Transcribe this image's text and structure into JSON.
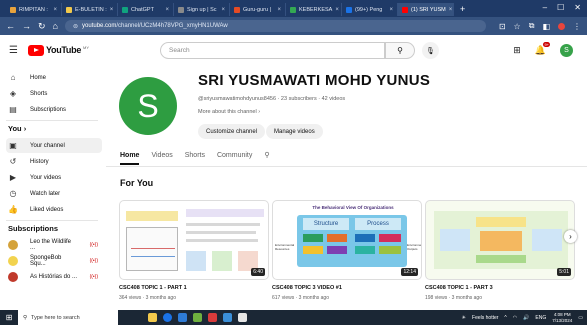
{
  "browser": {
    "tabs": [
      {
        "label": "RIMPITAN :",
        "color": "#e8a33d"
      },
      {
        "label": "E-BULETIN :",
        "color": "#f2c94c"
      },
      {
        "label": "ChatGPT",
        "color": "#10a37f"
      },
      {
        "label": "Sign up | Sc",
        "color": "#8a8a8a"
      },
      {
        "label": "Guru-guru |",
        "color": "#e44b25"
      },
      {
        "label": "KEBERKESA",
        "color": "#34a853"
      },
      {
        "label": "(99+) Peng",
        "color": "#1a73e8"
      },
      {
        "label": "(1) SRI YUSM",
        "color": "#ff0000"
      }
    ],
    "new_tab": "+",
    "url_domain": "youtube.com",
    "url_path": "/channel/UCzM4h78VPG_xmyHN1UWAw"
  },
  "youtube": {
    "logo_text": "YouTube",
    "logo_cc": "MY",
    "search_placeholder": "Search",
    "notif_badge": "9+",
    "user_initial": "S"
  },
  "sidebar": {
    "top": [
      {
        "label": "Home",
        "icon": "home-icon",
        "glyph": "⌂"
      },
      {
        "label": "Shorts",
        "icon": "shorts-icon",
        "glyph": "◈"
      },
      {
        "label": "Subscriptions",
        "icon": "subscriptions-icon",
        "glyph": "▤"
      }
    ],
    "you_heading": "You  ›",
    "you": [
      {
        "label": "Your channel",
        "icon": "your-channel-icon",
        "glyph": "▣"
      },
      {
        "label": "History",
        "icon": "history-icon",
        "glyph": "↺"
      },
      {
        "label": "Your videos",
        "icon": "your-videos-icon",
        "glyph": "▶"
      },
      {
        "label": "Watch later",
        "icon": "watch-later-icon",
        "glyph": "◷"
      },
      {
        "label": "Liked videos",
        "icon": "liked-videos-icon",
        "glyph": "👍"
      }
    ],
    "subs_heading": "Subscriptions",
    "subs": [
      {
        "label": "Leo the Wildlife ...",
        "color": "#d4a23a",
        "live": "((•))"
      },
      {
        "label": "SpongeBob Squ...",
        "color": "#f2d34f",
        "live": "((•))"
      },
      {
        "label": "As Histórias do ...",
        "color": "#c0392b",
        "live": "((•))"
      }
    ]
  },
  "channel": {
    "avatar_letter": "S",
    "name": "SRI YUSMAWATI MOHD YUNUS",
    "meta": "@sriyusmawatimohdyunus8456 · 23 subscribers · 42 videos",
    "about": "More about this channel  ›",
    "customize_label": "Customize channel",
    "manage_label": "Manage videos"
  },
  "tabs": [
    "Home",
    "Videos",
    "Shorts",
    "Community"
  ],
  "section_title": "For You",
  "videos": [
    {
      "title": "CSC408 TOPIC 1 - PART 1",
      "meta": "364 views · 3 months ago",
      "duration": "6:40"
    },
    {
      "title": "CSC408 TOPIC 3 VIDEO #1",
      "meta": "617 views · 3 months ago",
      "duration": "12:14",
      "thumb_heading": "The Behavioral View Of Organizations",
      "thumb_a": "Structure",
      "thumb_b": "Process",
      "thumb_in": "Environmental Resources",
      "thumb_out": "Environmental Outputs"
    },
    {
      "title": "CSC408 TOPIC 1 - PART 3",
      "meta": "198 views · 3 months ago",
      "duration": "5:01"
    }
  ],
  "taskbar": {
    "search_placeholder": "Type here to search",
    "weather": "Feels hotter",
    "lang": "ENG",
    "time": "4:08 PM",
    "date": "7/13/2024"
  }
}
